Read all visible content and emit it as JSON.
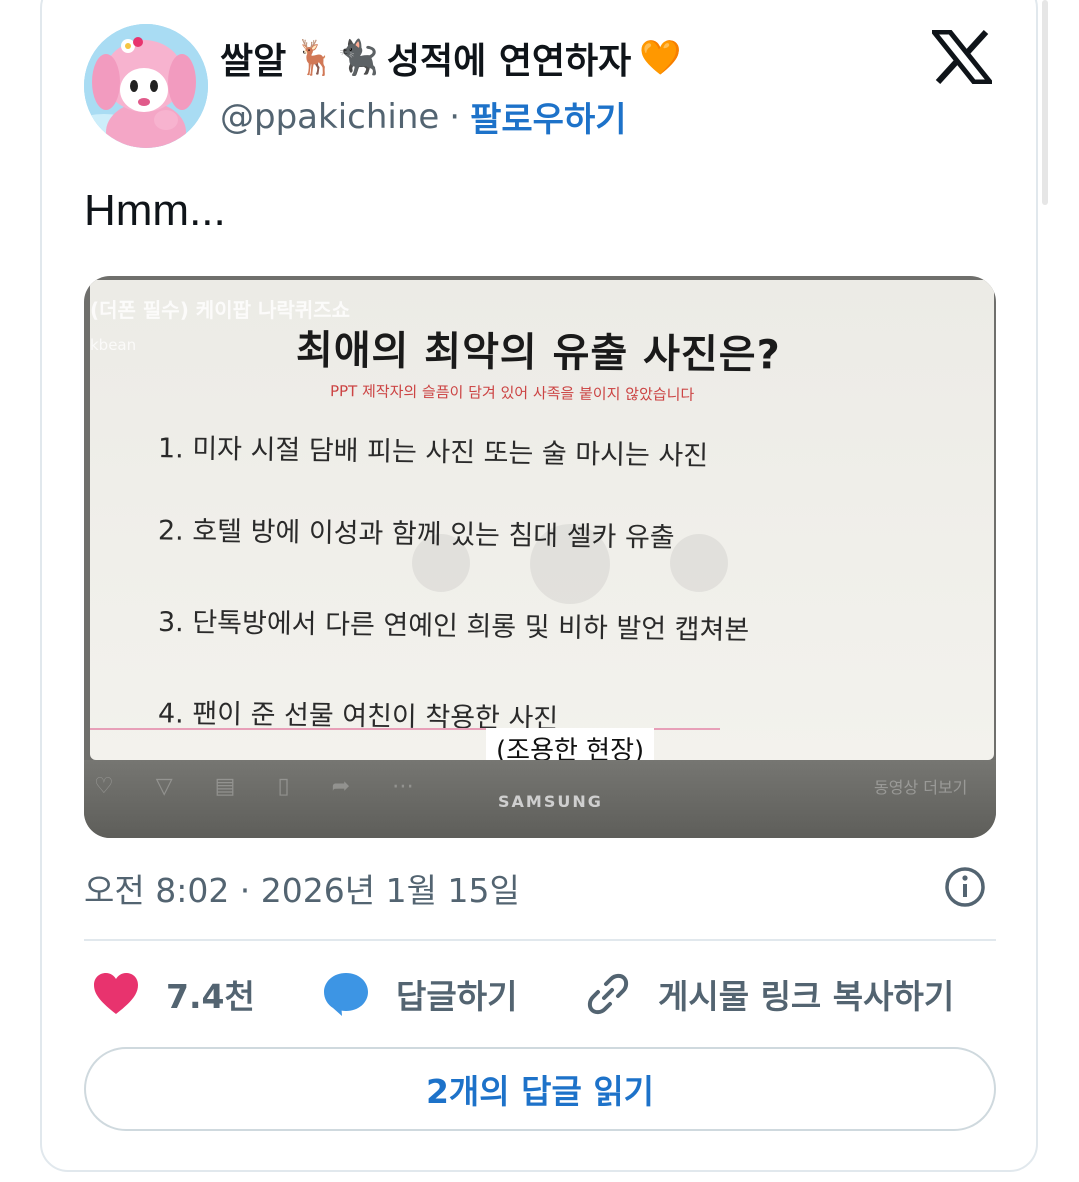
{
  "author": {
    "display_name": "쌀알 🦌🐈‍⬛ 성적에 연연하자",
    "name_text": "쌀알",
    "name_emojis": "🦌🐈‍⬛",
    "name_suffix": "성적에 연연하자",
    "heart_emoji": "🧡",
    "handle": "@ppakichine",
    "separator": "·",
    "follow_label": "팔로우하기"
  },
  "platform_logo": "x-logo",
  "tweet": {
    "text": "Hmm...",
    "timestamp": "오전 8:02 · 2026년 1월 15일"
  },
  "media": {
    "overlay_title": "(더폰 필수) 케이팝 나락퀴즈쇼",
    "overlay_channel": "kbean",
    "slide_title": "최애의 최악의 유출 사진은?",
    "slide_subtitle": "PPT 제작자의 슬픔이 담겨 있어 사족을 붙이지 않았습니다",
    "slide_items": [
      "1. 미자 시절  담배 피는 사진 또는 술 마시는 사진",
      "2. 호텔 방에 이성과 함께 있는 침대 셀카 유출",
      "3. 단톡방에서 다른 연예인 희롱 및 비하 발언 캡쳐본",
      "4. 팬이 준 선물 여친이 착용한 사진"
    ],
    "caption": "(조용한 현장)",
    "monitor_brand": "SAMSUNG",
    "more_video_label": "동영상 더보기"
  },
  "actions": {
    "like_count": "7.4천",
    "reply_label": "답글하기",
    "copy_link_label": "게시물 링크 복사하기"
  },
  "read_replies_label": "2개의 답글 읽기",
  "colors": {
    "like": "#e8336e",
    "reply": "#3d95e4",
    "link_blue": "#1d72c9",
    "muted": "#536471"
  }
}
